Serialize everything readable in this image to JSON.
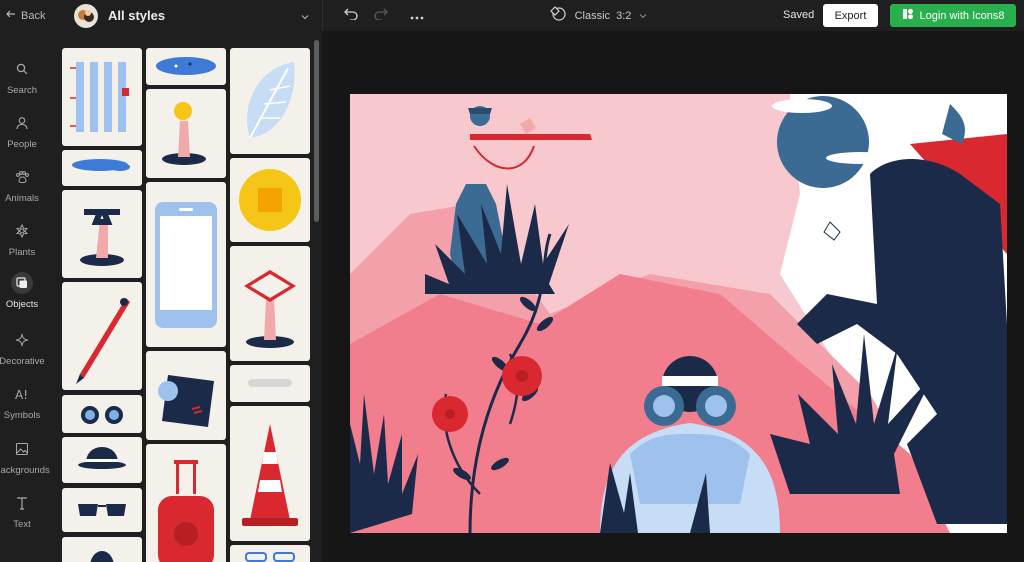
{
  "nav": {
    "back_label": "Back",
    "items": [
      {
        "label": "Search",
        "icon": "search-icon"
      },
      {
        "label": "People",
        "icon": "person-icon"
      },
      {
        "label": "Animals",
        "icon": "paw-icon"
      },
      {
        "label": "Plants",
        "icon": "flower-icon"
      },
      {
        "label": "Objects",
        "icon": "objects-icon",
        "active": true
      },
      {
        "label": "Decorative",
        "icon": "sparkle-icon"
      },
      {
        "label": "Symbols",
        "icon": "symbols-icon"
      },
      {
        "label": "Backgrounds",
        "icon": "image-icon"
      },
      {
        "label": "Text",
        "icon": "text-icon"
      }
    ]
  },
  "panel": {
    "title": "All styles"
  },
  "toolbar": {
    "size_label": "Classic  3:2",
    "saved_label": "Saved",
    "export_label": "Export",
    "login_label": "Login with Icons8"
  },
  "colors": {
    "accent_green": "#27b04c",
    "canvas_pink": "#f7c9cf",
    "hill_pink": "#f27d8c",
    "navy": "#1c2a4a",
    "red": "#d9282f"
  }
}
